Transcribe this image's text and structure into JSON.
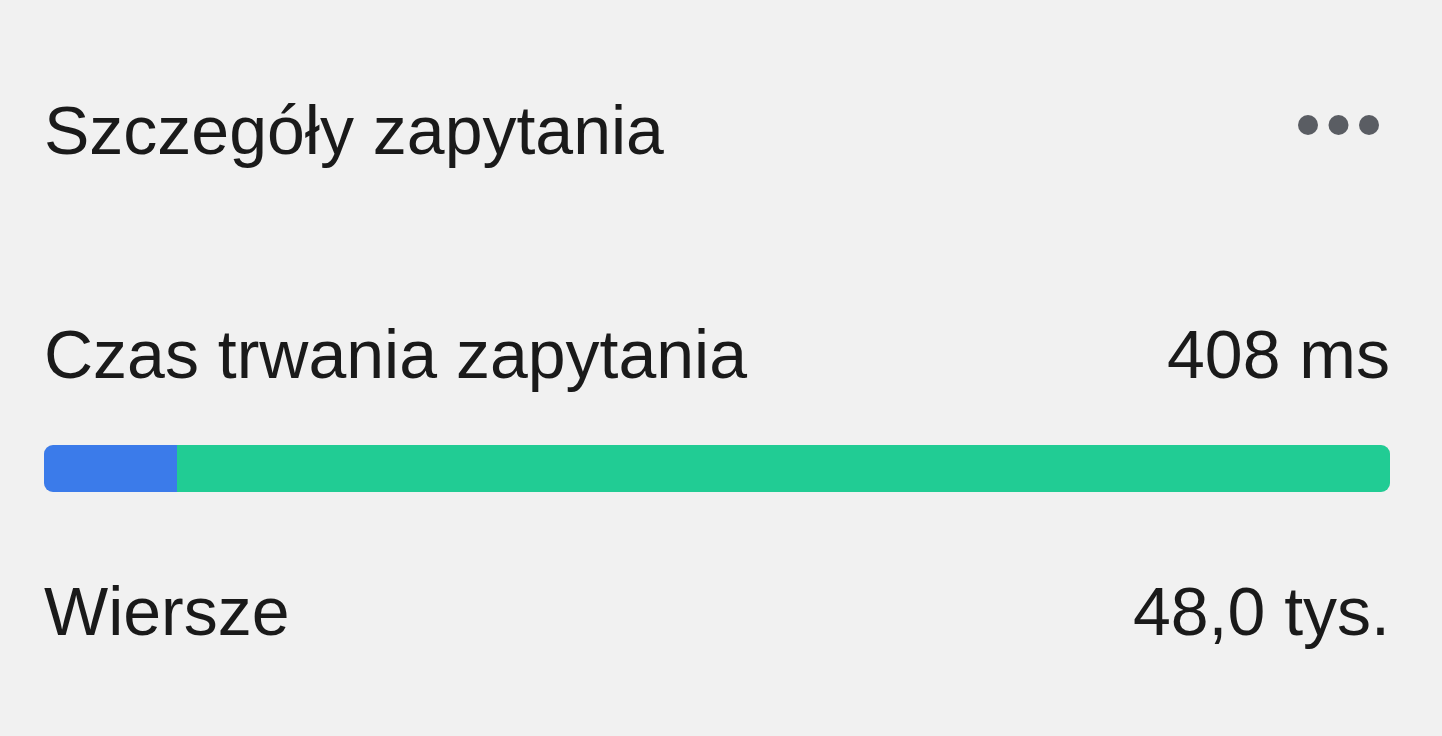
{
  "header": {
    "title": "Szczegóły zapytania"
  },
  "metrics": [
    {
      "kind": "bar",
      "label": "Czas trwania zapytania",
      "value": "408 ms",
      "segments": [
        {
          "color": "#3b7bea",
          "level": 0.099
        },
        {
          "color": "#21cc94",
          "level": 0.901
        }
      ]
    },
    {
      "kind": "plain",
      "label": "Wiersze",
      "value": "48,0 tys."
    }
  ]
}
